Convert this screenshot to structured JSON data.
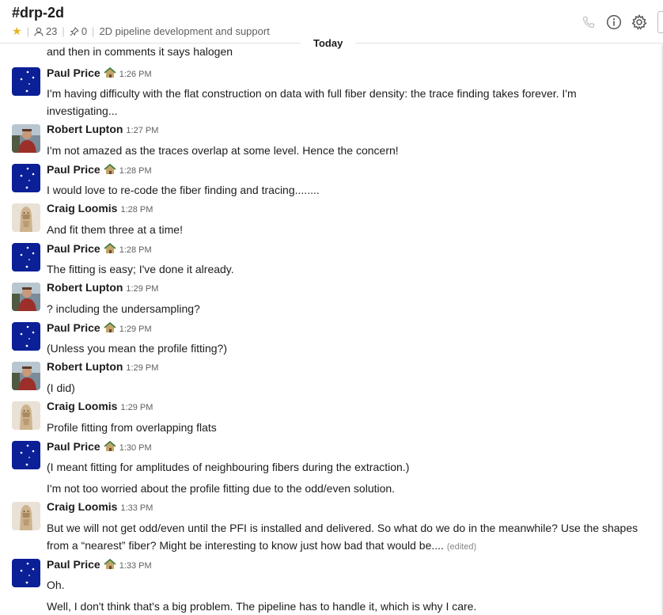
{
  "channel": {
    "name": "#drp-2d",
    "member_count": "23",
    "pin_count": "0",
    "topic": "2D pipeline development and support"
  },
  "divider": {
    "label": "Today"
  },
  "continuation_top": "and then in comments it says halogen",
  "messages": [
    {
      "sender": "Paul Price",
      "time": "1:26 PM",
      "avatar": "flag-avatar",
      "status": true,
      "lines": [
        "I'm having difficulty with the flat construction on data with full fiber density: the trace finding takes forever. I'm investigating..."
      ]
    },
    {
      "sender": "Robert Lupton",
      "time": "1:27 PM",
      "avatar": "photo-avatar",
      "status": false,
      "lines": [
        "I'm not amazed as the traces overlap at some level.  Hence the concern!"
      ]
    },
    {
      "sender": "Paul Price",
      "time": "1:28 PM",
      "avatar": "flag-avatar",
      "status": true,
      "lines": [
        "I would love to re-code the fiber finding and tracing........"
      ]
    },
    {
      "sender": "Craig Loomis",
      "time": "1:28 PM",
      "avatar": "statue-avatar",
      "status": false,
      "lines": [
        "And fit them three at a time!"
      ]
    },
    {
      "sender": "Paul Price",
      "time": "1:28 PM",
      "avatar": "flag-avatar",
      "status": true,
      "lines": [
        "The fitting is easy; I've done it already."
      ]
    },
    {
      "sender": "Robert Lupton",
      "time": "1:29 PM",
      "avatar": "photo-avatar",
      "status": false,
      "lines": [
        "? including the undersampling?"
      ]
    },
    {
      "sender": "Paul Price",
      "time": "1:29 PM",
      "avatar": "flag-avatar",
      "status": true,
      "lines": [
        "(Unless you mean the profile fitting?)"
      ]
    },
    {
      "sender": "Robert Lupton",
      "time": "1:29 PM",
      "avatar": "photo-avatar",
      "status": false,
      "lines": [
        "(I did)"
      ]
    },
    {
      "sender": "Craig Loomis",
      "time": "1:29 PM",
      "avatar": "statue-avatar",
      "status": false,
      "lines": [
        "Profile fitting from overlapping flats"
      ]
    },
    {
      "sender": "Paul Price",
      "time": "1:30 PM",
      "avatar": "flag-avatar",
      "status": true,
      "lines": [
        "(I meant fitting for amplitudes of neighbouring fibers during the extraction.)",
        "I'm not too worried about the profile fitting due to the odd/even solution."
      ]
    },
    {
      "sender": "Craig Loomis",
      "time": "1:33 PM",
      "avatar": "statue-avatar",
      "status": false,
      "lines": [
        "But we will not get odd/even until the PFI is installed and delivered. So what do we do in the meanwhile? Use the shapes from a “nearest” fiber? Might be interesting to know just how bad that would be...."
      ],
      "edited": "(edited)"
    },
    {
      "sender": "Paul Price",
      "time": "1:33 PM",
      "avatar": "flag-avatar",
      "status": true,
      "lines": [
        "Oh.",
        "Well, I don't think that's a big problem. The pipeline has to handle it, which is why I care."
      ]
    }
  ]
}
